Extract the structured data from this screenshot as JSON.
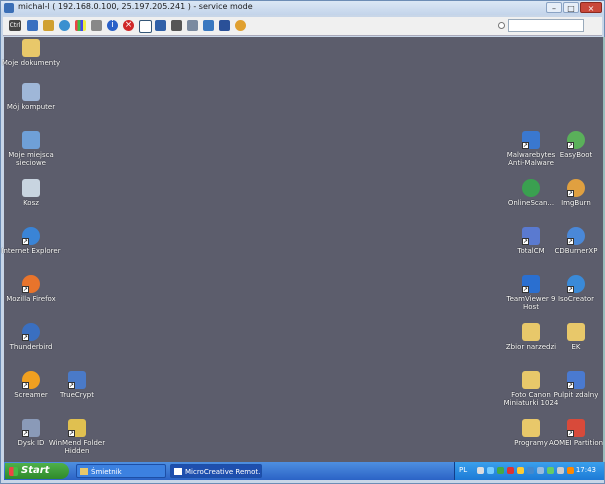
{
  "window": {
    "title": "michal-l ( 192.168.0.100, 25.197.205.241 ) - service mode",
    "controls": [
      "minimize",
      "maximize",
      "close"
    ]
  },
  "toolbar": {
    "icons": [
      "refresh-icon",
      "monitor-icon",
      "transfer-icon",
      "sync-icon",
      "windows-icon",
      "chat-icon",
      "info-icon",
      "stop-icon",
      "window-icon",
      "screen-icon",
      "keyboard-icon",
      "clipboard-icon",
      "files-icon",
      "network-icon",
      "connect-icon"
    ],
    "search_value": ""
  },
  "desktop": {
    "icons_left": [
      {
        "label": "Moje dokumenty",
        "icon": "folder-documents-icon",
        "color": "#e8c86a"
      },
      {
        "label": "Mój komputer",
        "icon": "computer-icon",
        "color": "#9fb7d8"
      },
      {
        "label": "Moje miejsca sieciowe",
        "icon": "network-places-icon",
        "color": "#6fa0d8"
      },
      {
        "label": "Kosz",
        "icon": "recycle-bin-icon",
        "color": "#c8d4e0"
      },
      {
        "label": "Internet Explorer",
        "icon": "internet-explorer-icon",
        "color": "#3a84d6"
      },
      {
        "label": "Mozilla Firefox",
        "icon": "firefox-icon",
        "color": "#e8742c"
      },
      {
        "label": "Thunderbird",
        "icon": "thunderbird-icon",
        "color": "#3a6fc0"
      },
      {
        "label": "Screamer",
        "icon": "screamer-icon",
        "color": "#f0a020"
      },
      {
        "label": "TrueCrypt",
        "icon": "truecrypt-icon",
        "color": "#4a7ac8"
      },
      {
        "label": "Dysk ID",
        "icon": "disk-id-icon",
        "color": "#8a9ab8"
      },
      {
        "label": "WinMend Folder Hidden",
        "icon": "winmend-icon",
        "color": "#e0c050"
      }
    ],
    "icons_right": [
      {
        "label": "Malwarebytes Anti-Malware",
        "icon": "malwarebytes-icon",
        "color": "#3a78d0"
      },
      {
        "label": "EasyBoot",
        "icon": "easyboot-icon",
        "color": "#5ab05a"
      },
      {
        "label": "OnlineScan...",
        "icon": "onlinescan-icon",
        "color": "#3aa050"
      },
      {
        "label": "ImgBurn",
        "icon": "imgburn-icon",
        "color": "#e0a040"
      },
      {
        "label": "TotalCM",
        "icon": "totalcm-icon",
        "color": "#5a7ad0"
      },
      {
        "label": "CDBurnerXP",
        "icon": "cdburnerxp-icon",
        "color": "#4a88d8"
      },
      {
        "label": "TeamViewer 9 Host",
        "icon": "teamviewer-icon",
        "color": "#2a6fd0"
      },
      {
        "label": "IsoCreator",
        "icon": "isocreator-icon",
        "color": "#3a8ad8"
      },
      {
        "label": "Zbior narzedzi",
        "icon": "folder-tools-icon",
        "color": "#e8c86a"
      },
      {
        "label": "EK",
        "icon": "folder-ek-icon",
        "color": "#e8c86a"
      },
      {
        "label": "Foto Canon Miniaturki 1024",
        "icon": "folder-photo-icon",
        "color": "#e8c86a"
      },
      {
        "label": "Pulpit zdalny",
        "icon": "remote-desktop-icon",
        "color": "#4a7ad0"
      },
      {
        "label": "Programy",
        "icon": "folder-programs-icon",
        "color": "#e8c86a"
      },
      {
        "label": "AOMEI Partition",
        "icon": "aomei-icon",
        "color": "#d84a3a"
      }
    ]
  },
  "taskbar": {
    "start_label": "Start",
    "tasks": [
      {
        "label": "Śmietnik",
        "icon": "folder-icon"
      },
      {
        "label": "MicroCreative Remot...",
        "icon": "remote-app-icon"
      }
    ],
    "lang": "PL",
    "clock": "17:43"
  },
  "colors": {
    "desktop": "#5c5d6c",
    "taskbar": "#2b63c6",
    "start": "#3a9a35"
  }
}
